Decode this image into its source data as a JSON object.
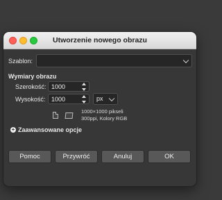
{
  "dialog": {
    "title": "Utworzenie nowego obrazu",
    "template_label": "Szablon:",
    "template_value": "",
    "section_title": "Wymiary obrazu",
    "width_label": "Szerokość:",
    "width_value": "1000",
    "height_label": "Wysokość:",
    "height_value": "1000",
    "unit_value": "px",
    "info_line1": "1000×1000 pikseli",
    "info_line2": "300ppi, Kolory RGB",
    "advanced_label": "Zaawansowane opcje",
    "buttons": {
      "help": "Pomoc",
      "reset": "Przywróć",
      "cancel": "Anuluj",
      "ok": "OK"
    }
  },
  "colors": {
    "background": "#3a3a3a",
    "dialog": "#373737",
    "titlebar": "#e4e4e4",
    "button": "#585858"
  }
}
